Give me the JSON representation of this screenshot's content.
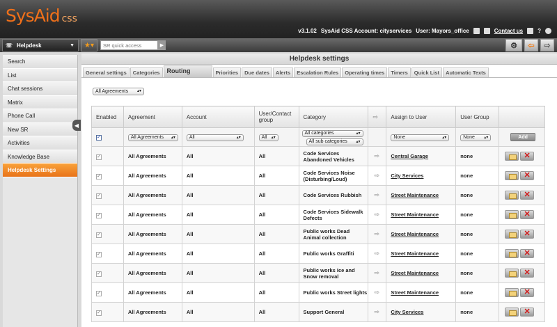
{
  "header": {
    "logo_text": "SysAid",
    "logo_suffix": "css",
    "version": "v3.1.02",
    "account": "SysAid CSS Account: cityservices",
    "user": "User: Mayors_office",
    "contact_us": "Contact us",
    "help": "?"
  },
  "toolbar": {
    "module": "Helpdesk",
    "quick_access_placeholder": "SR quick access"
  },
  "sidebar": {
    "items": [
      {
        "label": "Search"
      },
      {
        "label": "List"
      },
      {
        "label": "Chat sessions"
      },
      {
        "label": "Matrix"
      },
      {
        "label": "Phone Call"
      },
      {
        "label": "New SR"
      },
      {
        "label": "Activities"
      },
      {
        "label": "Knowledge Base"
      },
      {
        "label": "Helpdesk Settings"
      }
    ],
    "active_index": 8
  },
  "main": {
    "title": "Helpdesk settings",
    "tabs": [
      {
        "label": "General settings"
      },
      {
        "label": "Categories"
      },
      {
        "label": "Routing"
      },
      {
        "label": "Priorities"
      },
      {
        "label": "Due dates"
      },
      {
        "label": "Alerts"
      },
      {
        "label": "Escalation Rules"
      },
      {
        "label": "Operating times"
      },
      {
        "label": "Timers"
      },
      {
        "label": "Quick List"
      },
      {
        "label": "Automatic Texts"
      }
    ],
    "active_tab": "Routing",
    "agreement_filter": "All Agreements"
  },
  "table": {
    "headers": {
      "enabled": "Enabled",
      "agreement": "Agreement",
      "account": "Account",
      "user_contact_group": "User/Contact group",
      "category": "Category",
      "assign_to_user": "Assign to User",
      "user_group": "User Group"
    },
    "filter_row": {
      "agreement": "All Agreements",
      "account": "All",
      "user_contact": "All",
      "category": "All categories",
      "sub_category": "All sub categories",
      "assign_user": "None",
      "user_group": "None",
      "add_label": "Add"
    },
    "rows": [
      {
        "agreement": "All Agreements",
        "account": "All",
        "user_contact": "All",
        "category": "Code Services Abandoned Vehicles",
        "assign": "Central Garage",
        "group": "none"
      },
      {
        "agreement": "All Agreements",
        "account": "All",
        "user_contact": "All",
        "category": "Code Services Noise (Disturbing/Loud)",
        "assign": "City Services",
        "group": "none"
      },
      {
        "agreement": "All Agreements",
        "account": "All",
        "user_contact": "All",
        "category": "Code Services Rubbish",
        "assign": "Street Maintenance",
        "group": "none"
      },
      {
        "agreement": "All Agreements",
        "account": "All",
        "user_contact": "All",
        "category": "Code Services Sidewalk Defects",
        "assign": "Street Maintenance",
        "group": "none"
      },
      {
        "agreement": "All Agreements",
        "account": "All",
        "user_contact": "All",
        "category": "Public works Dead Animal collection",
        "assign": "Street Maintenance",
        "group": "none"
      },
      {
        "agreement": "All Agreements",
        "account": "All",
        "user_contact": "All",
        "category": "Public works Graffiti",
        "assign": "Street Maintenance",
        "group": "none"
      },
      {
        "agreement": "All Agreements",
        "account": "All",
        "user_contact": "All",
        "category": "Public works Ice and Snow removal",
        "assign": "Street Maintenance",
        "group": "none"
      },
      {
        "agreement": "All Agreements",
        "account": "All",
        "user_contact": "All",
        "category": "Public works Street lights",
        "assign": "Street Maintenance",
        "group": "none"
      },
      {
        "agreement": "All Agreements",
        "account": "All",
        "user_contact": "All",
        "category": "Support General",
        "assign": "City Services",
        "group": "none"
      }
    ]
  },
  "colors": {
    "accent": "#f0701a",
    "header_bg": "#2b2b2b"
  }
}
